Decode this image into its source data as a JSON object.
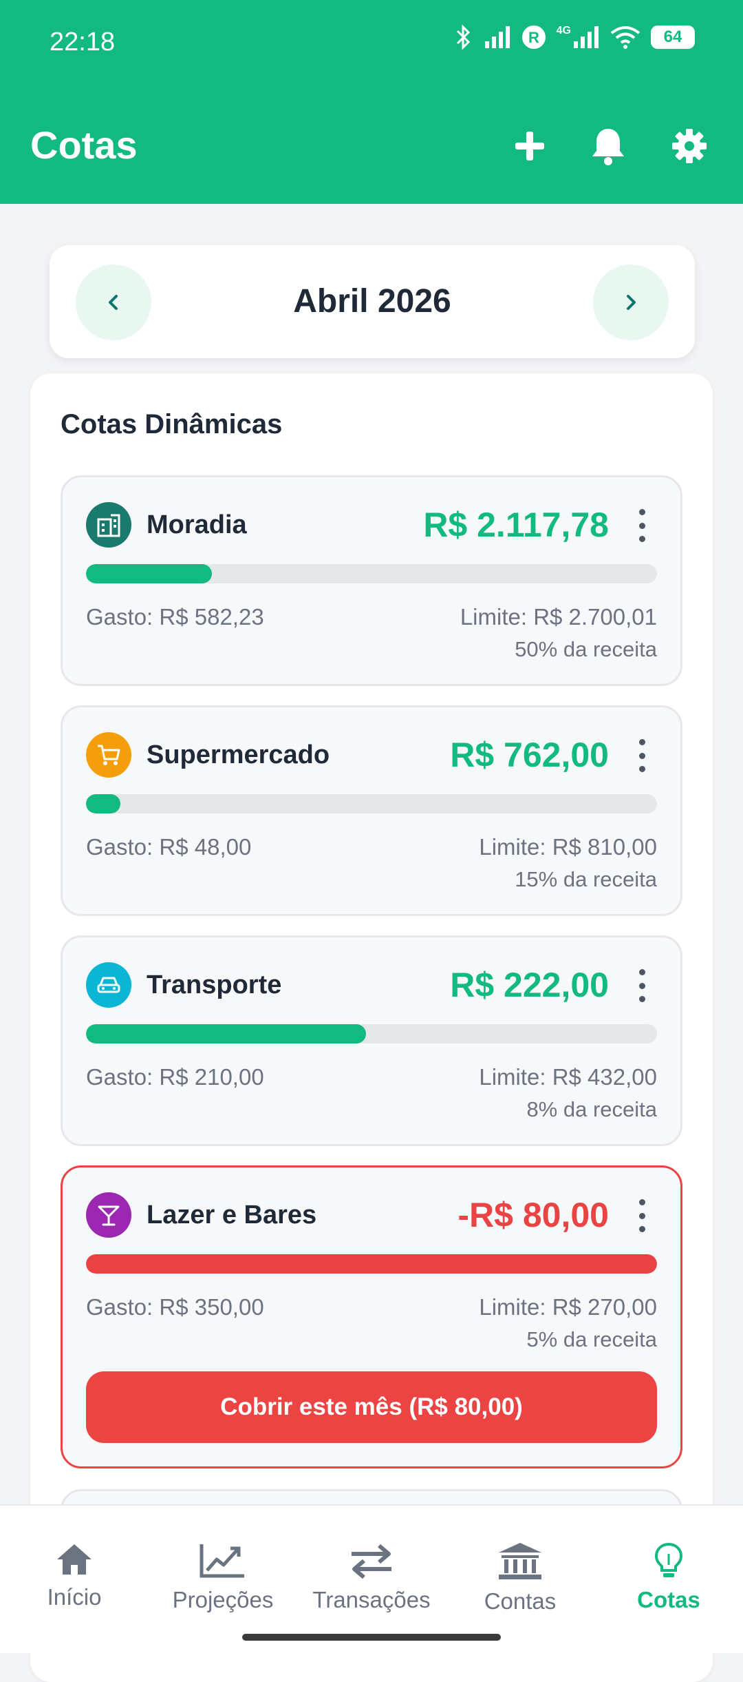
{
  "status": {
    "time": "22:18",
    "battery": "64",
    "network": "4G"
  },
  "appbar": {
    "title": "Cotas",
    "add_icon": "plus-icon",
    "bell_icon": "bell-icon",
    "settings_icon": "gear-icon"
  },
  "month_selector": {
    "label": "Abril 2026"
  },
  "panel": {
    "title": "Cotas Dinâmicas"
  },
  "quotas": [
    {
      "name": "Moradia",
      "icon": "building-icon",
      "color": "#1b7a6e",
      "amount": "R$ 2.117,78",
      "spent": "Gasto: R$ 582,23",
      "limit": "Limite: R$ 2.700,01",
      "share": "50% da receita",
      "progress": 0.22
    },
    {
      "name": "Supermercado",
      "icon": "cart-icon",
      "color": "#f59e0b",
      "amount": "R$ 762,00",
      "spent": "Gasto: R$ 48,00",
      "limit": "Limite: R$ 810,00",
      "share": "15% da receita",
      "progress": 0.06
    },
    {
      "name": "Transporte",
      "icon": "car-icon",
      "color": "#0ab6d4",
      "amount": "R$ 222,00",
      "spent": "Gasto: R$ 210,00",
      "limit": "Limite: R$ 432,00",
      "share": "8% da receita",
      "progress": 0.49
    },
    {
      "name": "Lazer e Bares",
      "icon": "cocktail-icon",
      "color": "#9c27b0",
      "amount": "-R$ 80,00",
      "spent": "Gasto: R$ 350,00",
      "limit": "Limite: R$ 270,00",
      "share": "5% da receita",
      "progress": 1.0,
      "cover_button": "Cobrir este mês (R$ 80,00)"
    }
  ],
  "bottom_nav": [
    {
      "label": "Início",
      "icon": "home-icon"
    },
    {
      "label": "Projeções",
      "icon": "chart-icon"
    },
    {
      "label": "Transações",
      "icon": "transfer-icon"
    },
    {
      "label": "Contas",
      "icon": "bank-icon"
    },
    {
      "label": "Cotas",
      "icon": "lightbulb-icon",
      "active": true
    }
  ],
  "colors": {
    "primary": "#12b981",
    "danger": "#e94343"
  }
}
